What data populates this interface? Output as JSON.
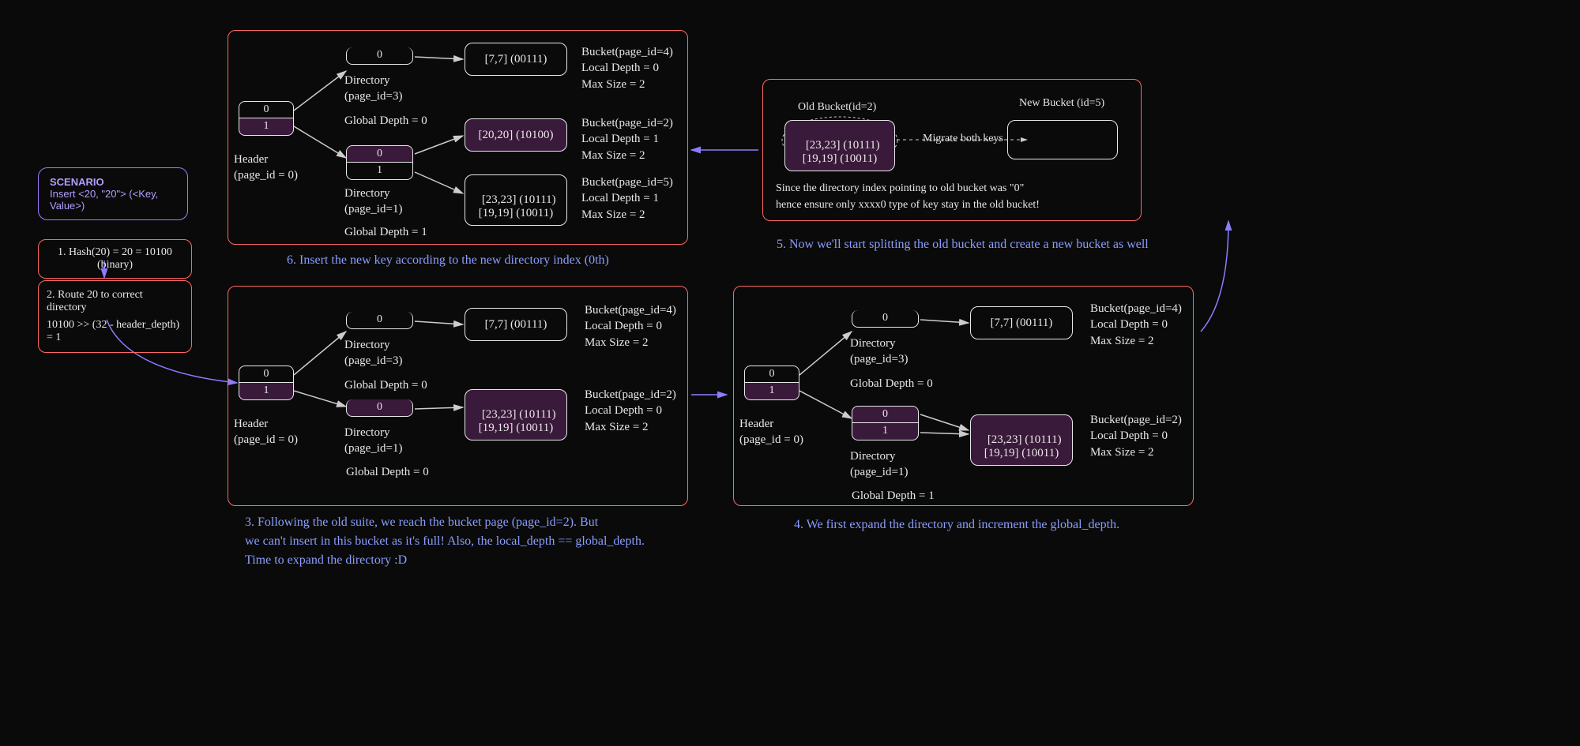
{
  "scenario": {
    "title": "SCENARIO",
    "text": "Insert <20, \"20\"> (<Key, Value>)"
  },
  "step1": {
    "text": "1. Hash(20) = 20 = 10100 (binary)"
  },
  "step2": {
    "line1": "2. Route 20 to correct directory",
    "line2": "10100 >> (32 - header_depth) = 1"
  },
  "captions": {
    "c3": "3. Following the old suite, we reach the bucket page (page_id=2). But\nwe can't insert in this bucket as it's full! Also, the local_depth == global_depth.\nTime to expand the directory :D",
    "c4": "4. We first expand the directory and increment the global_depth.",
    "c5": "5. Now we'll start splitting the old bucket and create a new bucket as well",
    "c6": "6. Insert the new key according to the new directory index (0th)"
  },
  "panel6": {
    "header": {
      "r0": "0",
      "r1": "1",
      "label": "Header\n(page_id = 0)"
    },
    "dir3": {
      "r0": "0",
      "label": "Directory\n(page_id=3)",
      "gd": "Global Depth = 0"
    },
    "dir1": {
      "r0": "0",
      "r1": "1",
      "label": "Directory\n(page_id=1)",
      "gd": "Global Depth = 1"
    },
    "bucket4": {
      "items": "[7,7] (00111)",
      "meta": "Bucket(page_id=4)\nLocal Depth = 0\nMax Size = 2"
    },
    "bucket2": {
      "items": "[20,20] (10100)",
      "meta": "Bucket(page_id=2)\nLocal Depth = 1\nMax Size = 2"
    },
    "bucket5": {
      "items": "[23,23] (10111)\n[19,19] (10011)",
      "meta": "Bucket(page_id=5)\nLocal Depth = 1\nMax Size = 2"
    }
  },
  "panel3": {
    "header": {
      "r0": "0",
      "r1": "1",
      "label": "Header\n(page_id = 0)"
    },
    "dir3": {
      "r0": "0",
      "label": "Directory\n(page_id=3)",
      "gd": "Global Depth = 0"
    },
    "dir1": {
      "r0": "0",
      "label": "Directory\n(page_id=1)",
      "gd": "Global Depth = 0"
    },
    "bucket4": {
      "items": "[7,7] (00111)",
      "meta": "Bucket(page_id=4)\nLocal Depth = 0\nMax Size = 2"
    },
    "bucket2": {
      "items": "[23,23] (10111)\n[19,19] (10011)",
      "meta": "Bucket(page_id=2)\nLocal Depth = 0\nMax Size = 2"
    }
  },
  "panel4": {
    "header": {
      "r0": "0",
      "r1": "1",
      "label": "Header\n(page_id = 0)"
    },
    "dir3": {
      "r0": "0",
      "label": "Directory\n(page_id=3)",
      "gd": "Global Depth = 0"
    },
    "dir1": {
      "r0": "0",
      "r1": "1",
      "label": "Directory\n(page_id=1)",
      "gd": "Global Depth = 1"
    },
    "bucket4": {
      "items": "[7,7] (00111)",
      "meta": "Bucket(page_id=4)\nLocal Depth = 0\nMax Size = 2"
    },
    "bucket2": {
      "items": "[23,23] (10111)\n[19,19] (10011)",
      "meta": "Bucket(page_id=2)\nLocal Depth = 0\nMax Size = 2"
    }
  },
  "panel5": {
    "old_label": "Old Bucket(id=2)",
    "new_label": "New Bucket (id=5)",
    "old_items": "[23,23] (10111)\n[19,19] (10011)",
    "migrate": "Migrate both keys",
    "note": "Since the directory index pointing to old bucket was \"0\"\nhence ensure only xxxx0 type of key stay in the old bucket!"
  }
}
